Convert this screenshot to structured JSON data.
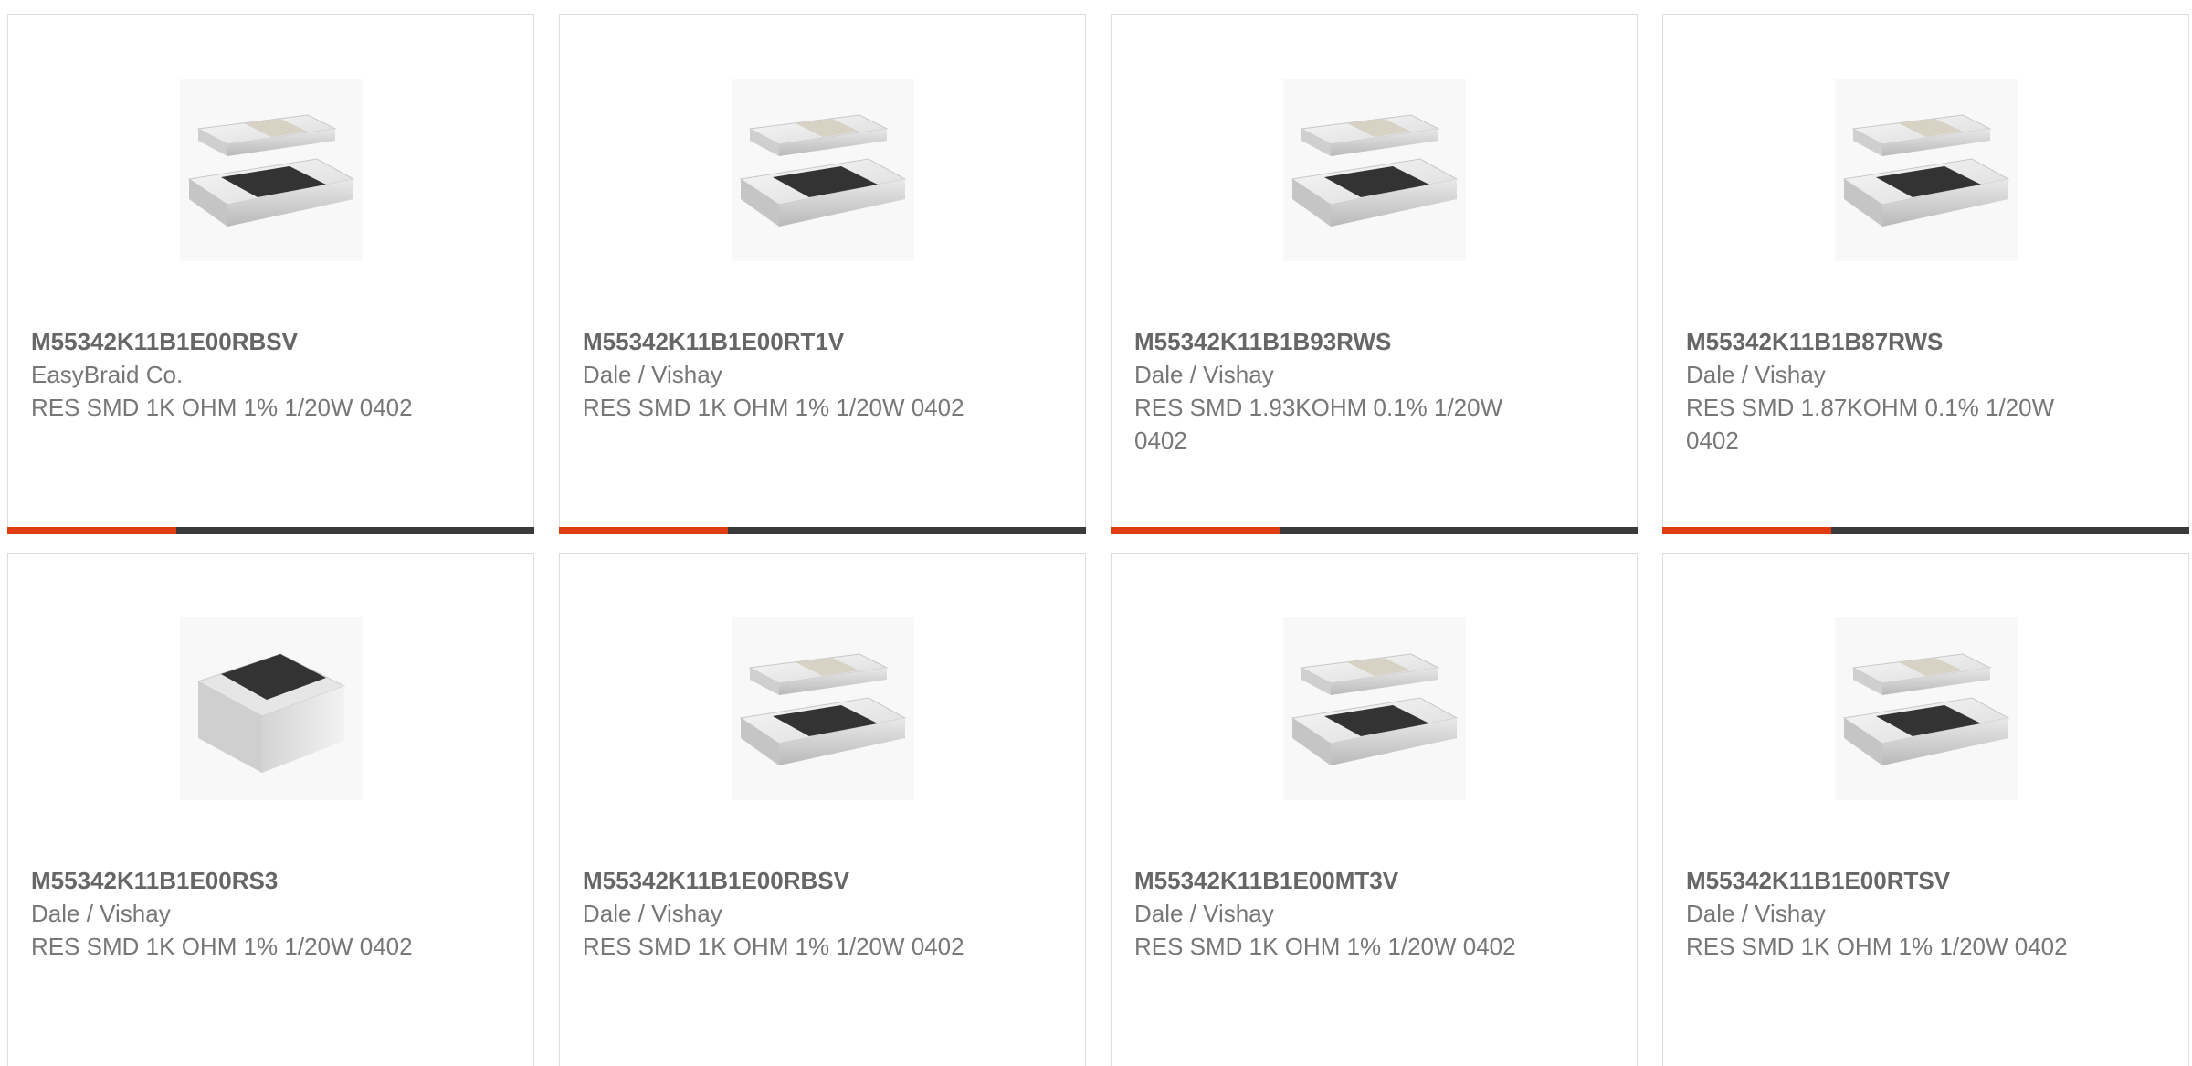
{
  "products": [
    {
      "part": "M55342K11B1E00RBSV",
      "manufacturer": "EasyBraid Co.",
      "description": "RES SMD 1K OHM 1% 1/20W 0402",
      "image": "chip-resistor-pair-icon",
      "progress": 0.32
    },
    {
      "part": "M55342K11B1E00RT1V",
      "manufacturer": "Dale / Vishay",
      "description": "RES SMD 1K OHM 1% 1/20W 0402",
      "image": "chip-resistor-pair-icon",
      "progress": 0.32
    },
    {
      "part": "M55342K11B1B93RWS",
      "manufacturer": "Dale / Vishay",
      "description": "RES SMD 1.93KOHM 0.1% 1/20W 0402",
      "image": "chip-resistor-pair-icon",
      "progress": 0.32
    },
    {
      "part": "M55342K11B1B87RWS",
      "manufacturer": "Dale / Vishay",
      "description": "RES SMD 1.87KOHM 0.1% 1/20W 0402",
      "image": "chip-resistor-pair-icon",
      "progress": 0.32
    },
    {
      "part": "M55342K11B1E00RS3",
      "manufacturer": "Dale / Vishay",
      "description": "RES SMD 1K OHM 1% 1/20W 0402",
      "image": "chip-resistor-single-icon",
      "progress": null
    },
    {
      "part": "M55342K11B1E00RBSV",
      "manufacturer": "Dale / Vishay",
      "description": "RES SMD 1K OHM 1% 1/20W 0402",
      "image": "chip-resistor-pair-icon",
      "progress": null
    },
    {
      "part": "M55342K11B1E00MT3V",
      "manufacturer": "Dale / Vishay",
      "description": "RES SMD 1K OHM 1% 1/20W 0402",
      "image": "chip-resistor-pair-icon",
      "progress": null
    },
    {
      "part": "M55342K11B1E00RTSV",
      "manufacturer": "Dale / Vishay",
      "description": "RES SMD 1K OHM 1% 1/20W 0402",
      "image": "chip-resistor-pair-icon",
      "progress": null
    }
  ],
  "colors": {
    "accent": "#e03c12",
    "track": "#3a3a3a",
    "text": "#666666",
    "border": "#dddddd"
  }
}
